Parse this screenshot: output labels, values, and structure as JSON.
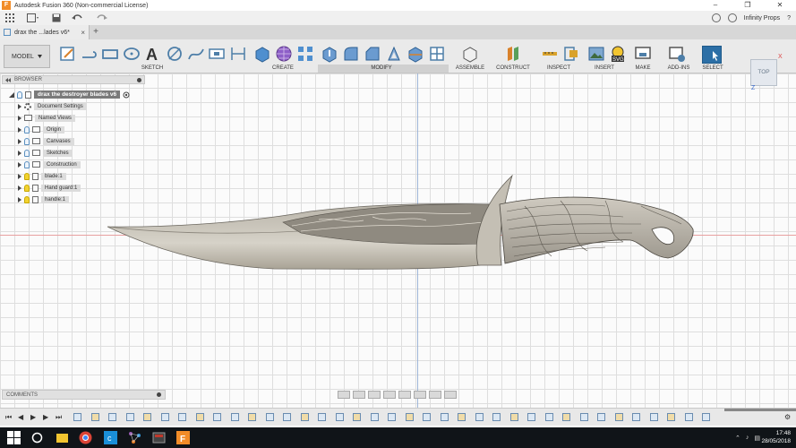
{
  "window": {
    "title": "Autodesk Fusion 360 (Non-commercial License)",
    "app_icon": "F",
    "minimize": "–",
    "maximize": "❐",
    "close": "✕"
  },
  "quick_access": {
    "account": "Infinity Props",
    "help": "?"
  },
  "document_tab": {
    "label": "drax the ...lades v6*",
    "close": "×",
    "new_tab": "+"
  },
  "toolbar": {
    "workspace": "MODEL",
    "groups": [
      "SKETCH",
      "CREATE",
      "MODIFY",
      "ASSEMBLE",
      "CONSTRUCT",
      "INSPECT",
      "INSERT",
      "MAKE",
      "ADD-INS",
      "SELECT"
    ]
  },
  "browser": {
    "header": "BROWSER",
    "root": "drax the destroyer blades v6",
    "nodes": [
      {
        "label": "Document Settings",
        "icon": "gear-icon",
        "light": "none"
      },
      {
        "label": "Named Views",
        "icon": "folder-icon",
        "light": "none"
      },
      {
        "label": "Origin",
        "icon": "folder-icon",
        "light": "off"
      },
      {
        "label": "Canvases",
        "icon": "folder-icon",
        "light": "off"
      },
      {
        "label": "Sketches",
        "icon": "folder-icon",
        "light": "off"
      },
      {
        "label": "Construction",
        "icon": "folder-icon",
        "light": "off"
      },
      {
        "label": "blade:1",
        "icon": "body-icon",
        "light": "on"
      },
      {
        "label": "Hand guard:1",
        "icon": "body-icon",
        "light": "on"
      },
      {
        "label": "handle:1",
        "icon": "body-icon",
        "light": "on"
      }
    ]
  },
  "viewcube": {
    "face": "TOP",
    "x_axis": "X",
    "z_axis": "Z"
  },
  "comments": {
    "label": "COMMENTS"
  },
  "taskbar": {
    "time": "17:48",
    "date": "28/05/2018"
  },
  "colors": {
    "accent": "#2c6fa6",
    "canvas_grid": "#dedede",
    "x_axis": "#e8a0a0",
    "z_axis": "#9fb6d8"
  }
}
